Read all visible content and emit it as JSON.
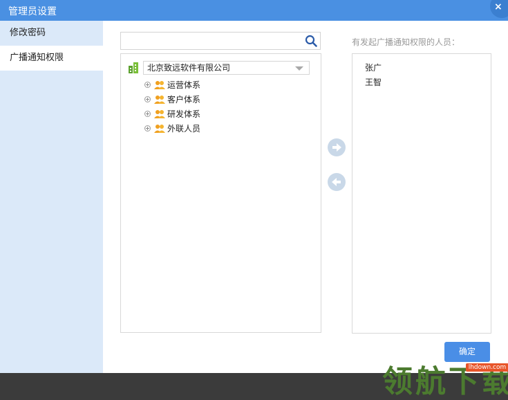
{
  "window": {
    "title": "管理员设置",
    "close_label": "×"
  },
  "sidebar": {
    "items": [
      {
        "label": "修改密码",
        "active": false
      },
      {
        "label": "广播通知权限",
        "active": true
      }
    ]
  },
  "search": {
    "value": "",
    "placeholder": ""
  },
  "tree": {
    "organization": "北京致远软件有限公司",
    "nodes": [
      {
        "label": "运营体系",
        "icon": "group-icon"
      },
      {
        "label": "客户体系",
        "icon": "group-icon"
      },
      {
        "label": "研发体系",
        "icon": "group-icon"
      },
      {
        "label": "外联人员",
        "icon": "group-icon"
      }
    ]
  },
  "right_panel": {
    "label": "有发起广播通知权限的人员：",
    "people": [
      "张广",
      "王智"
    ]
  },
  "buttons": {
    "ok_label": "确定"
  },
  "watermark": {
    "text": "领航下载",
    "url": "lhdown.com"
  },
  "colors": {
    "accent": "#4a90e2",
    "sidebar": "#dbe9f9",
    "button": "#4a8ee6",
    "arrow": "#c9d8e8",
    "footer": "#3b3b3b"
  }
}
